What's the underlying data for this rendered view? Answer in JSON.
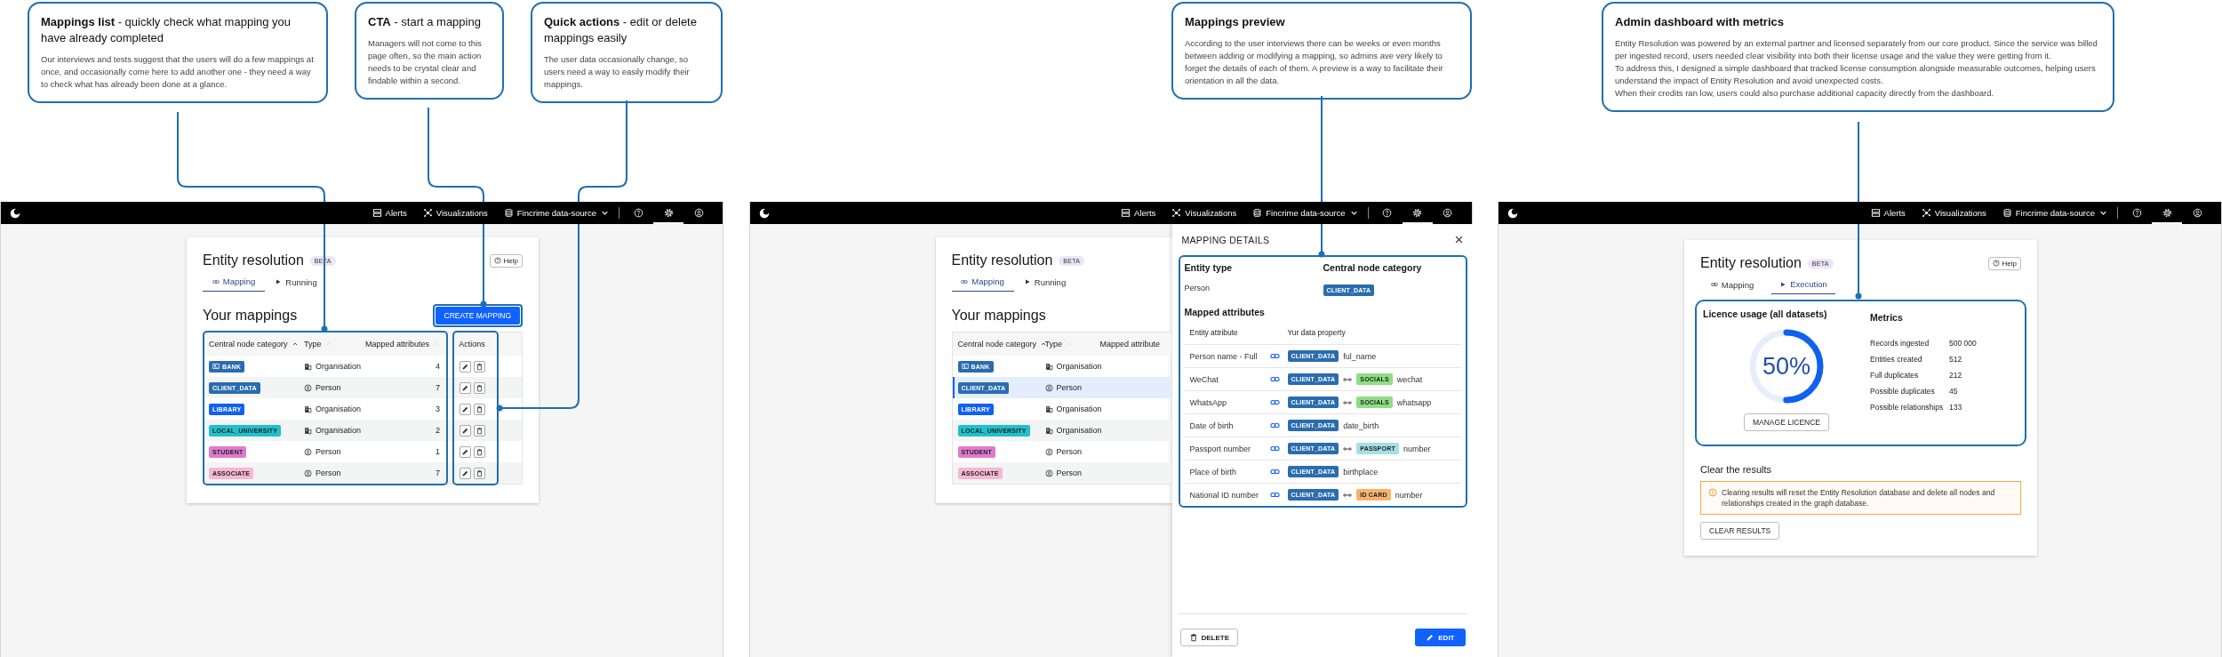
{
  "callouts": [
    {
      "kind": "lead",
      "title": "**Mappings list** - quickly check what mapping you have already completed",
      "body": "Our interviews and tests suggest that the users will do a few mappings at once, and occasionally come here to add another one - they need a way to check what has already been done at a glance."
    },
    {
      "kind": "lead",
      "title": "**CTA** - start a mapping",
      "body": "Managers will not come to this page often, so the main action needs to be crystal clear and findable within a second."
    },
    {
      "kind": "lead",
      "title": "**Quick actions** - edit or delete mappings easily",
      "body": "The user data occasionally change, so users need a way to easily modify their mappings."
    },
    {
      "kind": "headline",
      "title": "Mappings preview",
      "body": "According to the user interviews there can be weeks or even months between adding or modifying a mapping, so admins ave very likely to forget the details of each of them. A preview is a way to facilitate their orientation in all the data."
    },
    {
      "kind": "headline",
      "title": "Admin dashboard with metrics",
      "body": "Entity Resolution was powered by an external partner and licensed separately from our core product. Since the service was billed per ingested record, users needed clear visibility into both their license usage and the value they were getting from it.\nTo address this, I designed a simple dashboard that tracked license consumption alongside measurable outcomes, helping users understand the impact of Entity Resolution and avoid unexpected costs.\nWhen their credits ran low, users could also purchase additional capacity directly from the dashboard."
    }
  ],
  "panels": [
    {
      "kind": "mappings",
      "nav": {
        "items": [
          {
            "label": "Alerts"
          },
          {
            "label": "Visualizations"
          }
        ],
        "source": "Fincrime data-source",
        "icons": [
          {
            "selected": false
          },
          {
            "selected": true
          },
          {
            "selected": false
          }
        ]
      },
      "card": {
        "title": "Entity resolution",
        "badge": "BETA",
        "help": "Help",
        "tabs": [
          {
            "label": "Mapping",
            "selected": true
          },
          {
            "label": "Running",
            "selected": false
          }
        ],
        "heading": "Your mappings",
        "create": "CREATE MAPPING",
        "columns": [
          {
            "label": "Central node category",
            "sorted": true
          },
          {
            "label": "Type",
            "sorted": false
          },
          {
            "label": "Mapped attributes",
            "sorted": false
          }
        ],
        "actions_column": "Actions",
        "rows": [
          {
            "category": {
              "label": "BANK",
              "color": "#2a6cb0",
              "icon": true
            },
            "kind": "organisation",
            "type": "Organisation",
            "count": "4"
          },
          {
            "category": {
              "label": "CLIENT_DATA",
              "color": "#2a6cb0",
              "icon": false
            },
            "kind": "person",
            "type": "Person",
            "count": "7"
          },
          {
            "category": {
              "label": "LIBRARY",
              "color": "#1061f0",
              "icon": false
            },
            "kind": "organisation",
            "type": "Organisation",
            "count": "3"
          },
          {
            "category": {
              "label": "LOCAL_UNIVERSITY",
              "color": "#20c0cc",
              "icon": false
            },
            "kind": "organisation",
            "type": "Organisation",
            "count": "2"
          },
          {
            "category": {
              "label": "STUDENT",
              "color": "#e07ad0",
              "icon": false
            },
            "kind": "person",
            "type": "Person",
            "count": "1"
          },
          {
            "category": {
              "label": "ASSOCIATE",
              "color": "#f6b8d4",
              "icon": false
            },
            "kind": "person",
            "type": "Person",
            "count": "7"
          }
        ]
      }
    },
    {
      "kind": "mapping_details",
      "nav": {
        "items": [
          {
            "label": "Alerts"
          },
          {
            "label": "Visualizations"
          }
        ],
        "source": "Fincrime data-source",
        "icons": [
          {
            "selected": false
          },
          {
            "selected": true
          },
          {
            "selected": false
          }
        ]
      },
      "card": {
        "title": "Entity resolution",
        "badge": "BETA",
        "tabs": [
          {
            "label": "Mapping",
            "selected": true
          },
          {
            "label": "Running",
            "selected": false
          }
        ],
        "heading": "Your mappings",
        "columns": [
          {
            "label": "Central node category",
            "sorted": true
          },
          {
            "label": "Type",
            "sorted": false
          },
          {
            "label": "Mapped attribute"
          }
        ],
        "rows": [
          {
            "category": {
              "label": "BANK",
              "color": "#2a6cb0",
              "icon": true
            },
            "kind": "organisation",
            "type": "Organisation",
            "selected": false
          },
          {
            "category": {
              "label": "CLIENT_DATA",
              "color": "#2a6cb0",
              "icon": false
            },
            "kind": "person",
            "type": "Person",
            "selected": true
          },
          {
            "category": {
              "label": "LIBRARY",
              "color": "#1061f0",
              "icon": false
            },
            "kind": "organisation",
            "type": "Organisation",
            "selected": false
          },
          {
            "category": {
              "label": "LOCAL_UNIVERSITY",
              "color": "#20c0cc",
              "icon": false
            },
            "kind": "organisation",
            "type": "Organisation",
            "selected": false
          },
          {
            "category": {
              "label": "STUDENT",
              "color": "#e07ad0",
              "icon": false
            },
            "kind": "person",
            "type": "Person",
            "selected": false
          },
          {
            "category": {
              "label": "ASSOCIATE",
              "color": "#f6b8d4",
              "icon": false
            },
            "kind": "person",
            "type": "Person",
            "selected": false
          }
        ]
      },
      "drawer": {
        "title": "MAPPING DETAILS",
        "entity_type": {
          "label": "Entity type",
          "value": "Person"
        },
        "central": {
          "label": "Central node category",
          "tag": {
            "label": "CLIENT_DATA",
            "color": "#2a6cb0"
          }
        },
        "attributes_title": "Mapped attributes",
        "columns": [
          "Entity attribute",
          "Yur data property"
        ],
        "rows": [
          {
            "attribute": "Person name - Full",
            "tags": [
              {
                "label": "CLIENT_DATA",
                "color": "#2a6cb0"
              }
            ],
            "field": "ful_name"
          },
          {
            "attribute": "WeChat",
            "tags": [
              {
                "label": "CLIENT_DATA",
                "color": "#2a6cb0"
              },
              {
                "label": "SOCIALS",
                "color": "#8ede84"
              }
            ],
            "field": "wechat"
          },
          {
            "attribute": "WhatsApp",
            "tags": [
              {
                "label": "CLIENT_DATA",
                "color": "#2a6cb0"
              },
              {
                "label": "SOCIALS",
                "color": "#8ede84"
              }
            ],
            "field": "whatsapp"
          },
          {
            "attribute": "Date of birth",
            "tags": [
              {
                "label": "CLIENT_DATA",
                "color": "#2a6cb0"
              }
            ],
            "field": "date_birth"
          },
          {
            "attribute": "Passport number",
            "tags": [
              {
                "label": "CLIENT_DATA",
                "color": "#2a6cb0"
              },
              {
                "label": "PASSPORT",
                "color": "#a7dfe6"
              }
            ],
            "field": "number"
          },
          {
            "attribute": "Place of birth",
            "tags": [
              {
                "label": "CLIENT_DATA",
                "color": "#2a6cb0"
              }
            ],
            "field": "birthplace"
          },
          {
            "attribute": "National ID number",
            "tags": [
              {
                "label": "CLIENT_DATA",
                "color": "#2a6cb0"
              },
              {
                "label": "ID CARD",
                "color": "#f7b36c"
              }
            ],
            "field": "number"
          }
        ],
        "delete": "DELETE",
        "edit": "EDIT"
      }
    },
    {
      "kind": "execution",
      "nav": {
        "items": [
          {
            "label": "Alerts"
          },
          {
            "label": "Visualizations"
          }
        ],
        "source": "Fincrime data-source",
        "icons": [
          {
            "selected": false
          },
          {
            "selected": true
          },
          {
            "selected": false
          }
        ]
      },
      "card": {
        "title": "Entity resolution",
        "badge": "BETA",
        "help": "Help",
        "tabs": [
          {
            "label": "Mapping",
            "selected": false
          },
          {
            "label": "Execution",
            "selected": true
          }
        ],
        "usage": {
          "title": "Licence usage (all datasets)",
          "level": 0.5,
          "reading": "50%",
          "button": "MANAGE LICENCE"
        },
        "metrics": {
          "title": "Metrics",
          "rows": [
            {
              "label": "Records ingested",
              "value": "500 000"
            },
            {
              "label": "Entities created",
              "value": "512"
            },
            {
              "label": "Full duplicates",
              "value": "212"
            },
            {
              "label": "Possible duplicates",
              "value": "45"
            },
            {
              "label": "Possible relationships",
              "value": "133"
            }
          ]
        },
        "clear": {
          "title": "Clear the results",
          "warning": "Clearing results will reset the Entity Resolution database and delete all nodes and relationships created in the graph database.",
          "button": "CLEAR RESULTS"
        }
      }
    }
  ]
}
